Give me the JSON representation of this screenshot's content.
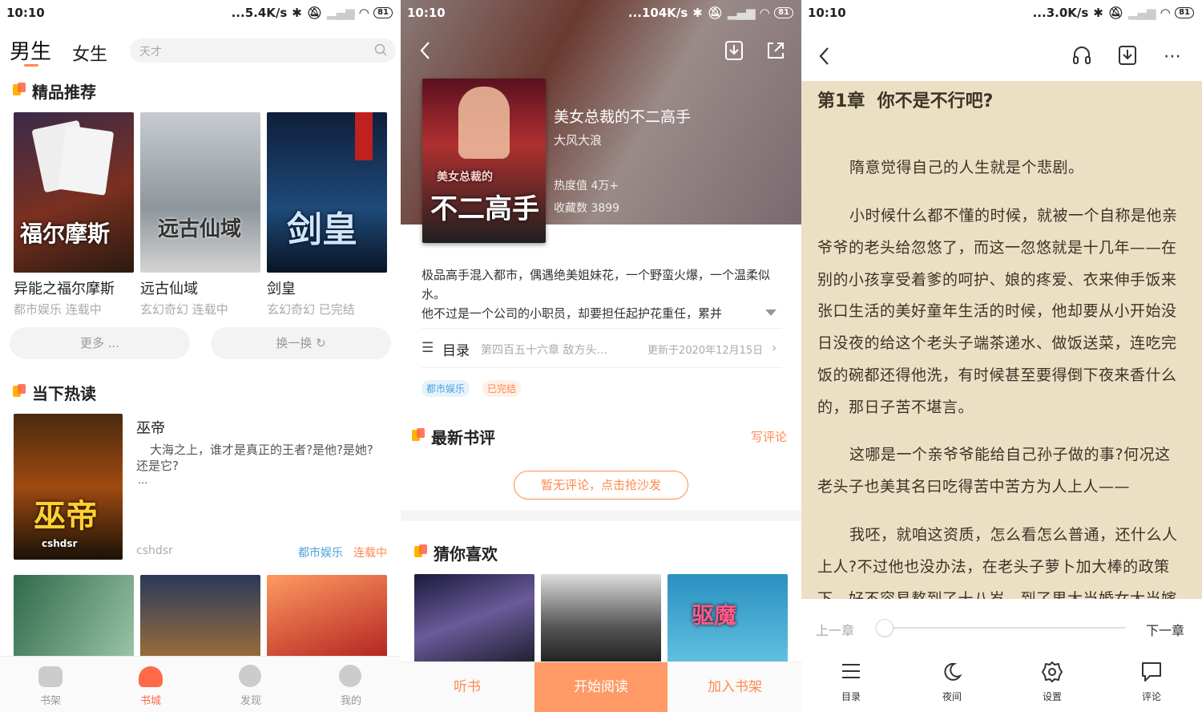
{
  "status_bars": [
    {
      "time": "10:10",
      "speed": "...5.4K/s",
      "battery": "81"
    },
    {
      "time": "10:10",
      "speed": "...104K/s",
      "battery": "81"
    },
    {
      "time": "10:10",
      "speed": "...3.0K/s",
      "battery": "81"
    }
  ],
  "store": {
    "tabs": [
      "男生",
      "女生"
    ],
    "search_placeholder": "天才",
    "featured": {
      "title": "精品推荐",
      "books": [
        {
          "title": "异能之福尔摩斯",
          "meta": "都市娱乐 连载中"
        },
        {
          "title": "远古仙域",
          "meta": "玄幻奇幻 连载中"
        },
        {
          "title": "剑皇",
          "meta": "玄幻奇幻 已完结"
        }
      ],
      "more_label": "更多 ...",
      "refresh_label": "换一换"
    },
    "hot": {
      "title": "当下热读",
      "book": {
        "title": "巫帝",
        "desc": "大海之上，谁才是真正的王者?是他?是她?还是它?",
        "ellipsis": "...",
        "author": "cshdsr",
        "category": "都市娱乐",
        "status": "连载中"
      }
    },
    "bottom_nav": [
      {
        "label": "书架"
      },
      {
        "label": "书城"
      },
      {
        "label": "发现"
      },
      {
        "label": "我的"
      }
    ]
  },
  "detail": {
    "title": "美女总裁的不二高手",
    "author": "大风大浪",
    "heat": "热度值 4万+",
    "favorites": "收藏数 3899",
    "cover_text_small": "美女总裁的",
    "cover_text_big": "不二高手",
    "intro_1": "极品高手混入都市，偶遇绝美姐妹花，一个野蛮火爆，一个温柔似水。",
    "intro_2": "他不过是一个公司的小职员，却要担任起护花重任，累并",
    "toc_label": "目录",
    "latest_chapter": "第四百五十六章 敌方头...",
    "updated": "更新于2020年12月15日",
    "tags": [
      "都市娱乐",
      "已完结"
    ],
    "reviews_title": "最新书评",
    "write_review": "写评论",
    "no_review": "暂无评论，点击抢沙发",
    "guess_title": "猜你喜欢",
    "actions": {
      "listen": "听书",
      "read": "开始阅读",
      "add_shelf": "加入书架"
    }
  },
  "reader": {
    "chapter_title": "第1章  你不是不行吧?",
    "paragraphs": [
      "隋意觉得自己的人生就是个悲剧。",
      "小时候什么都不懂的时候，就被一个自称是他亲爷爷的老头给忽悠了，而这一忽悠就是十几年——在别的小孩享受着爹的呵护、娘的疼爱、衣来伸手饭来张口生活的美好童年生活的时候，他却要从小开始没日没夜的给这个老头子端茶递水、做饭送菜，连吃完饭的碗都还得他洗，有时候甚至要得倒下夜来香什么的，那日子苦不堪言。",
      "这哪是一个亲爷爷能给自己孙子做的事?何况这老头子也美其名曰吃得苦中苦方为人上人——",
      "我呸，就咱这资质，怎么看怎么普通，还什么人上人?不过他也没办法，在老头子萝卜加大棒的政策下，好不容易熬到了十八岁，到了男大当婚女大当嫁"
    ],
    "prev_chapter": "上一章",
    "next_chapter": "下一章",
    "progress": 0,
    "toolbar": [
      {
        "label": "目录"
      },
      {
        "label": "夜间"
      },
      {
        "label": "设置"
      },
      {
        "label": "评论"
      }
    ]
  },
  "colors": {
    "accent": "#ff8a50",
    "blue_tag": "#4aa3df",
    "reader_bg": "#ece0c4"
  }
}
